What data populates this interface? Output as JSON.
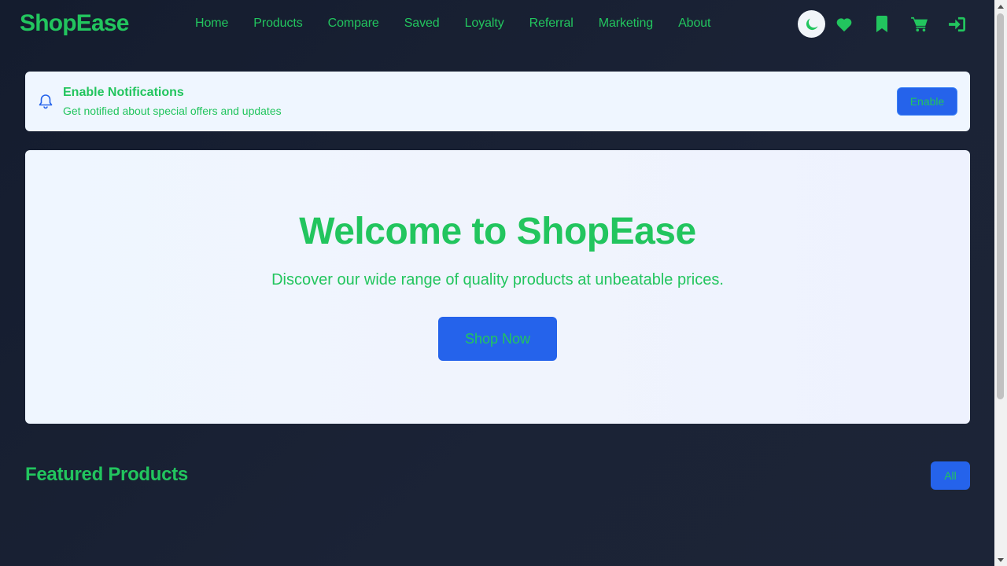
{
  "brand": {
    "name": "ShopEase",
    "color": "#22c55e"
  },
  "nav": {
    "items": [
      {
        "label": "Home"
      },
      {
        "label": "Products"
      },
      {
        "label": "Compare"
      },
      {
        "label": "Saved"
      },
      {
        "label": "Loyalty"
      },
      {
        "label": "Referral"
      },
      {
        "label": "Marketing"
      },
      {
        "label": "About"
      }
    ]
  },
  "header_actions": {
    "icons": [
      "moon-icon",
      "heart-icon",
      "bookmark-icon",
      "cart-icon",
      "sign-in-icon"
    ]
  },
  "notification": {
    "icon": "bell-icon",
    "title": "Enable Notifications",
    "description": "Get notified about special offers and updates",
    "button_label": "Enable"
  },
  "hero": {
    "title": "Welcome to ShopEase",
    "subtitle": "Discover our wide range of quality products at unbeatable prices.",
    "cta_label": "Shop Now"
  },
  "featured": {
    "title": "Featured Products",
    "filter_label": "All"
  },
  "colors": {
    "accent_text": "#22c55e",
    "primary_button": "#2563eb",
    "background": "#1b2336",
    "card": "#eff6ff"
  }
}
